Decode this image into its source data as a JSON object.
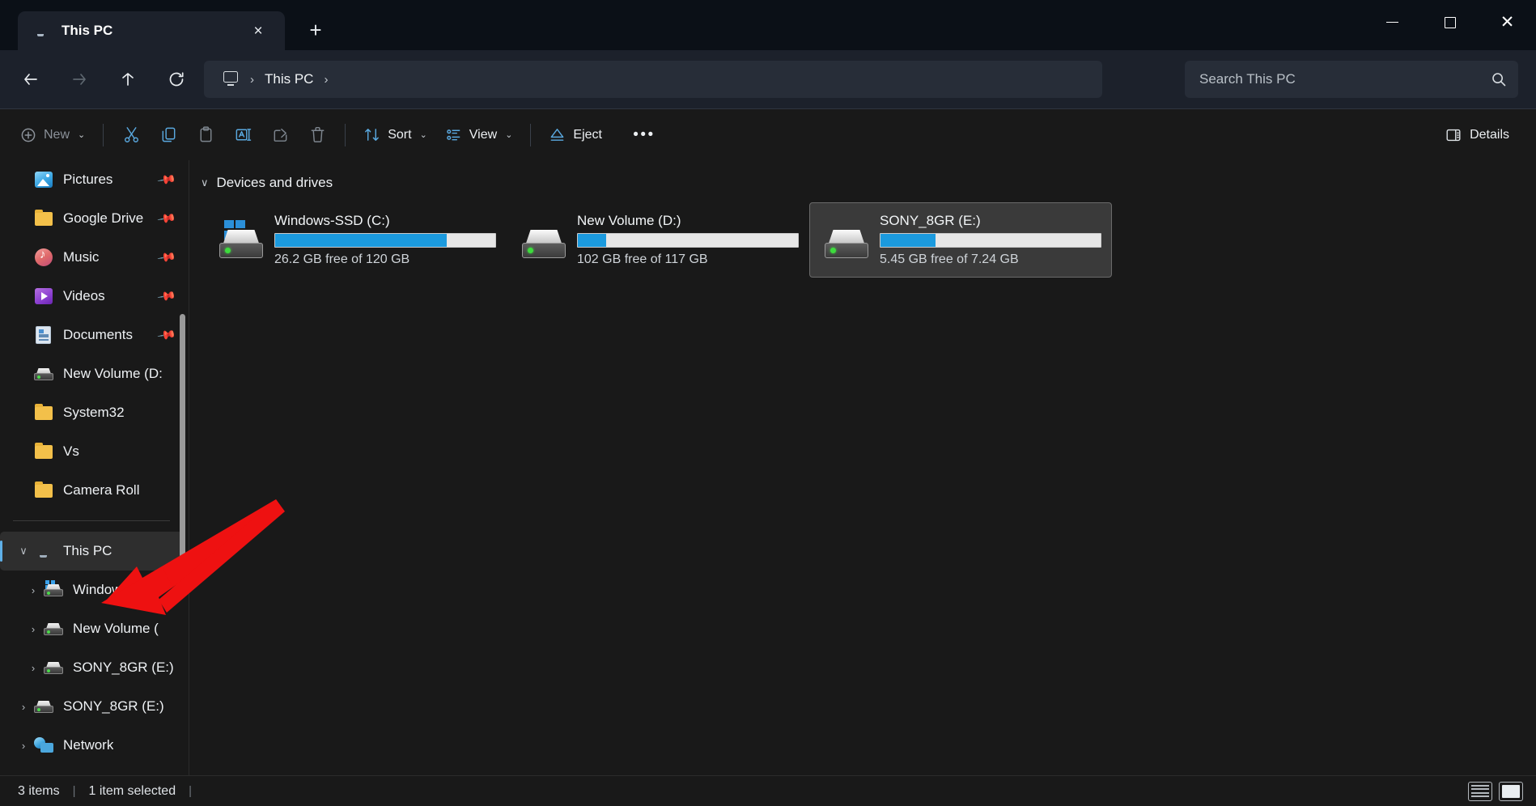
{
  "window": {
    "tab_title": "This PC",
    "tab_icon": "monitor-icon",
    "close_label": "×",
    "newtab_label": "+",
    "minimize_label": "Minimize",
    "maximize_label": "Maximize",
    "close_window_label": "Close"
  },
  "nav": {
    "back": "back-arrow",
    "forward": "forward-arrow",
    "up": "up-arrow",
    "refresh": "refresh-icon",
    "breadcrumb": {
      "root_icon": "this-pc-icon",
      "sep1": "›",
      "current": "This PC",
      "sep2": "›"
    }
  },
  "search": {
    "placeholder": "Search This PC",
    "icon": "search-icon"
  },
  "toolbar": {
    "new_label": "New",
    "new_chevron": "⌄",
    "cut_label": "Cut",
    "copy_label": "Copy",
    "paste_label": "Paste",
    "rename_label": "Rename",
    "share_label": "Share",
    "delete_label": "Delete",
    "sort_label": "Sort",
    "sort_chevron": "⌄",
    "view_label": "View",
    "view_chevron": "⌄",
    "eject_label": "Eject",
    "more_label": "•••",
    "details_label": "Details"
  },
  "sidebar": {
    "items": [
      {
        "label": "Pictures",
        "icon": "pictures-icon",
        "pinned": true,
        "twisty": "",
        "indent": 0
      },
      {
        "label": "Google Drive",
        "icon": "folder-icon",
        "pinned": true,
        "twisty": "",
        "indent": 0
      },
      {
        "label": "Music",
        "icon": "music-icon",
        "pinned": true,
        "twisty": "",
        "indent": 0
      },
      {
        "label": "Videos",
        "icon": "videos-icon",
        "pinned": true,
        "twisty": "",
        "indent": 0
      },
      {
        "label": "Documents",
        "icon": "documents-icon",
        "pinned": true,
        "twisty": "",
        "indent": 0
      },
      {
        "label": "New Volume (D:",
        "icon": "drive-icon",
        "pinned": false,
        "twisty": "",
        "indent": 0
      },
      {
        "label": "System32",
        "icon": "folder-icon",
        "pinned": false,
        "twisty": "",
        "indent": 0
      },
      {
        "label": "Vs",
        "icon": "folder-icon",
        "pinned": false,
        "twisty": "",
        "indent": 0
      },
      {
        "label": "Camera Roll",
        "icon": "folder-icon",
        "pinned": false,
        "twisty": "",
        "indent": 0
      }
    ],
    "tree": [
      {
        "label": "This PC",
        "icon": "this-pc-icon",
        "twisty": "∨",
        "indent": 0,
        "selected": true
      },
      {
        "label": "Windows-SSD",
        "icon": "windows-drive-icon",
        "twisty": "›",
        "indent": 1,
        "selected": false
      },
      {
        "label": "New Volume (",
        "icon": "drive-icon",
        "twisty": "›",
        "indent": 1,
        "selected": false
      },
      {
        "label": "SONY_8GR (E:)",
        "icon": "drive-icon",
        "twisty": "›",
        "indent": 1,
        "selected": false
      },
      {
        "label": "SONY_8GR (E:)",
        "icon": "drive-icon",
        "twisty": "›",
        "indent": 0,
        "selected": false
      },
      {
        "label": "Network",
        "icon": "network-icon",
        "twisty": "›",
        "indent": 0,
        "selected": false
      }
    ]
  },
  "main": {
    "group_title": "Devices and drives",
    "group_chevron": "∨",
    "drives": [
      {
        "name": "Windows-SSD (C:)",
        "usage_text": "26.2 GB free of 120 GB",
        "free_gb": 26.2,
        "total_gb": 120,
        "used_percent": 78,
        "icon": "windows-drive-icon",
        "selected": false,
        "bar_color": "#1b9ade"
      },
      {
        "name": "New Volume (D:)",
        "usage_text": "102 GB free of 117 GB",
        "free_gb": 102,
        "total_gb": 117,
        "used_percent": 13,
        "icon": "drive-icon",
        "selected": false,
        "bar_color": "#1b9ade"
      },
      {
        "name": "SONY_8GR (E:)",
        "usage_text": "5.45 GB free of 7.24 GB",
        "free_gb": 5.45,
        "total_gb": 7.24,
        "used_percent": 25,
        "icon": "drive-icon",
        "selected": true,
        "bar_color": "#1b9ade"
      }
    ]
  },
  "status": {
    "item_count": "3 items",
    "divider1": "|",
    "selection": "1 item selected",
    "divider2": "|",
    "list_view_icon": "list-view-icon",
    "details_view_icon": "details-view-icon"
  },
  "annotation": {
    "arrow_color": "#ee1111",
    "points_to": "This PC"
  }
}
